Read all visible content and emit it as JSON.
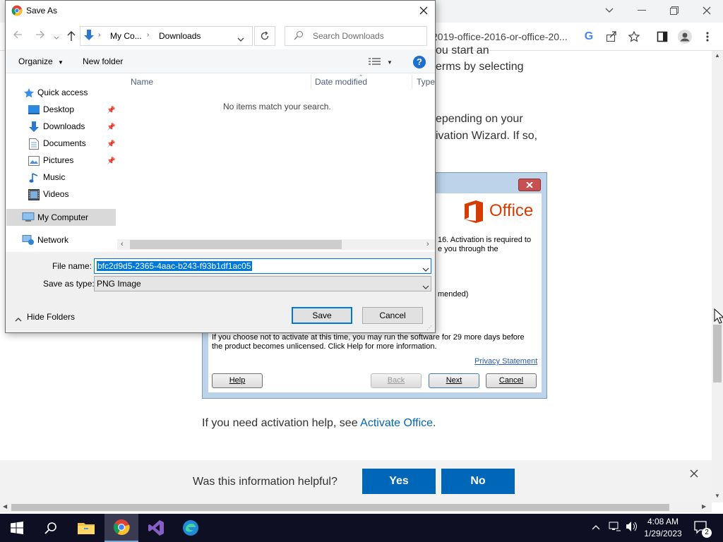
{
  "browser": {
    "url_text": "2019-office-2016-or-office-20...",
    "window_controls": {
      "dropdown": "chevron-down",
      "minimize": "minimize",
      "restore": "restore",
      "close": "close"
    }
  },
  "article": {
    "line1": "ou start an",
    "line2": "erms by selecting",
    "line3": "epending on your",
    "line4": "ivation Wizard. If so,",
    "bottom_text": "If you need activation help, see ",
    "bottom_link": "Activate Office",
    "bottom_end": "."
  },
  "wizard": {
    "brand": "Office",
    "text1": "16. Activation is required to",
    "text2": "e you through the",
    "text3": "mended)",
    "info1": "If you choose not to activate at this time, you may run the software for 29 more days before",
    "info2": "the product becomes unlicensed. Click Help for more information.",
    "privacy": "Privacy Statement",
    "help": "Help",
    "back": "Back",
    "next": "Next",
    "cancel": "Cancel",
    "colors": {
      "frame": "#bcd3ea",
      "office_orange": "#d83b01",
      "close_red": "#c75050"
    }
  },
  "feedback": {
    "question": "Was this information helpful?",
    "yes": "Yes",
    "no": "No",
    "button_color": "#0067b8"
  },
  "dialog": {
    "title": "Save As",
    "breadcrumb": [
      "My Co...",
      "Downloads"
    ],
    "search_placeholder": "Search Downloads",
    "organize": "Organize",
    "new_folder": "New folder",
    "columns": [
      "Name",
      "Date modified",
      "Type"
    ],
    "empty_message": "No items match your search.",
    "nav": {
      "quick_access": "Quick access",
      "items": [
        {
          "label": "Desktop",
          "icon": "desktop-icon",
          "pinned": true
        },
        {
          "label": "Downloads",
          "icon": "downloads-icon",
          "pinned": true
        },
        {
          "label": "Documents",
          "icon": "documents-icon",
          "pinned": true
        },
        {
          "label": "Pictures",
          "icon": "pictures-icon",
          "pinned": true
        },
        {
          "label": "Music",
          "icon": "music-icon",
          "pinned": false
        },
        {
          "label": "Videos",
          "icon": "videos-icon",
          "pinned": false
        }
      ],
      "my_computer": "My Computer",
      "network": "Network"
    },
    "file_name_label": "File name:",
    "file_name_value": "bfc2d9d5-2365-4aac-b243-f93b1df1ac05",
    "save_type_label": "Save as type:",
    "save_type_value": "PNG Image",
    "hide_folders": "Hide Folders",
    "save": "Save",
    "cancel": "Cancel"
  },
  "taskbar": {
    "time": "4:08 AM",
    "date": "1/29/2023",
    "notifications": "2",
    "apps": [
      "windows-start",
      "search",
      "file-explorer",
      "chrome",
      "visual-studio",
      "edge"
    ]
  }
}
